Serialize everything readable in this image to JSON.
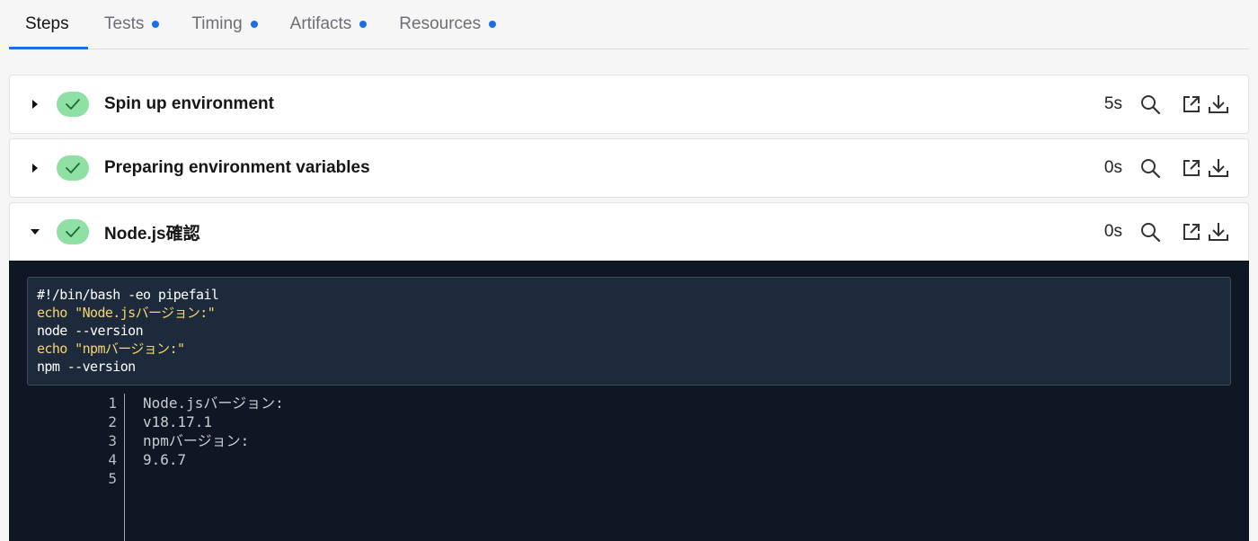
{
  "tabs": [
    {
      "label": "Steps",
      "active": true,
      "dot": false
    },
    {
      "label": "Tests",
      "active": false,
      "dot": true
    },
    {
      "label": "Timing",
      "active": false,
      "dot": true
    },
    {
      "label": "Artifacts",
      "active": false,
      "dot": true
    },
    {
      "label": "Resources",
      "active": false,
      "dot": true
    }
  ],
  "steps": [
    {
      "title": "Spin up environment",
      "duration": "5s",
      "status": "success",
      "expanded": false
    },
    {
      "title": "Preparing environment variables",
      "duration": "0s",
      "status": "success",
      "expanded": false
    },
    {
      "title": "Node.js確認",
      "duration": "0s",
      "status": "success",
      "expanded": true
    }
  ],
  "command": [
    {
      "text": "#!/bin/bash -eo pipefail",
      "highlight": false
    },
    {
      "text": "echo \"Node.jsバージョン:\"",
      "highlight": true
    },
    {
      "text": "node --version",
      "highlight": false
    },
    {
      "text": "echo \"npmバージョン:\"",
      "highlight": true
    },
    {
      "text": "npm --version",
      "highlight": false
    }
  ],
  "output": [
    {
      "n": "1",
      "text": "Node.jsバージョン:"
    },
    {
      "n": "2",
      "text": "v18.17.1"
    },
    {
      "n": "3",
      "text": "npmバージョン:"
    },
    {
      "n": "4",
      "text": "9.6.7"
    },
    {
      "n": "5",
      "text": ""
    }
  ],
  "colors": {
    "accent": "#1a6ee8",
    "success": "#8fe0a4",
    "console_bg": "#0f1724",
    "command_highlight": "#f3d66b"
  },
  "icons": {
    "search": "search-icon",
    "open": "external-link-icon",
    "download": "download-icon"
  }
}
